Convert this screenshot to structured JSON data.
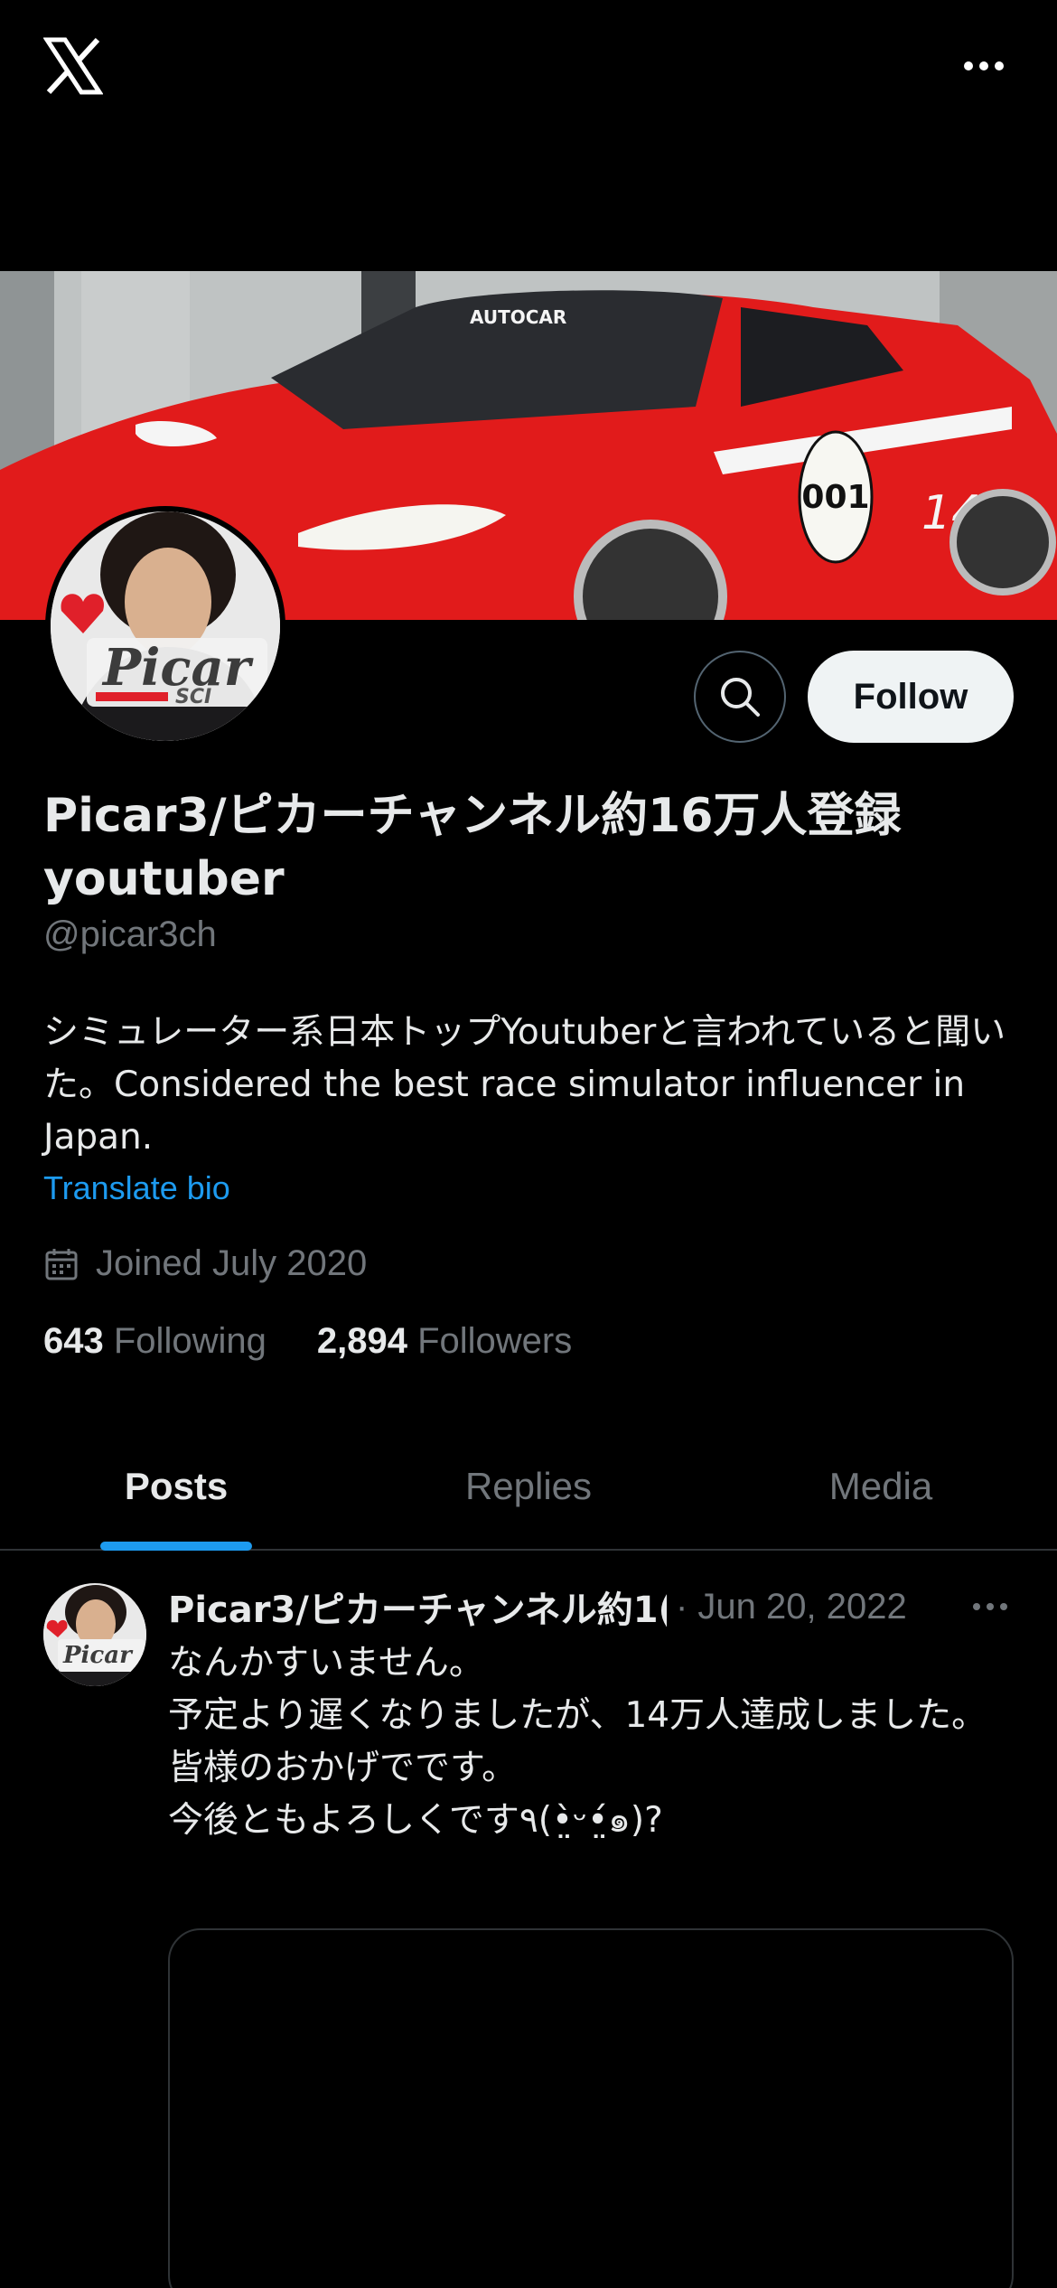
{
  "app": {
    "logo": "x-logo",
    "more_icon": "more-horizontal-icon"
  },
  "profile": {
    "display_name": "Picar3/ピカーチャンネル約16万人登録youtuber",
    "handle": "@picar3ch",
    "bio": "シミュレーター系日本トップYoutuberと言われていると聞いた。Considered the best race simulator influencer in Japan.",
    "translate_label": "Translate bio",
    "joined": "Joined July 2020",
    "following_count": "643",
    "following_label": "Following",
    "followers_count": "2,894",
    "followers_label": "Followers",
    "follow_button": "Follow",
    "avatar_text": "Picar",
    "avatar_sub": "SCI",
    "banner_car_number": "001",
    "banner_side_number": "14",
    "banner_sticker": "AUTOCAR"
  },
  "tabs": [
    {
      "label": "Posts",
      "active": true
    },
    {
      "label": "Replies",
      "active": false
    },
    {
      "label": "Media",
      "active": false
    }
  ],
  "post": {
    "author": "Picar3/ピカーチャンネル約1(",
    "date": "· Jun 20, 2022",
    "text": "なんかすいません。\n予定より遅くなりましたが、14万人達成しました。\n皆様のおかげでです。\n今後ともよろしくです٩(•̤̀ᵕ•̤́๑)?",
    "avatar_text": "Picar"
  },
  "colors": {
    "accent": "#1d9bf0",
    "background": "#000000",
    "muted": "#71767b",
    "text": "#e7e9ea",
    "banner_car": "#e11b1b"
  }
}
